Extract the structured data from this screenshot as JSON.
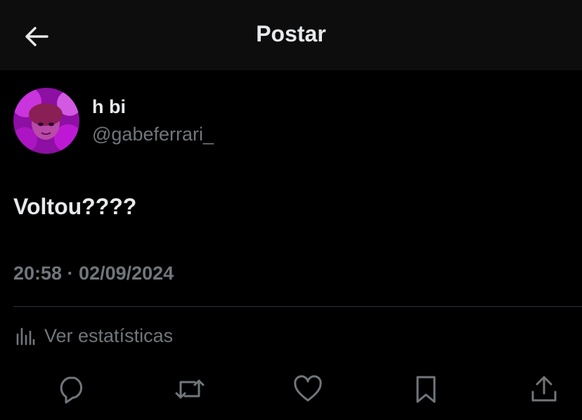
{
  "header": {
    "title": "Postar",
    "back_icon": "arrow-left-icon"
  },
  "author": {
    "display_name": "h bi",
    "handle": "@gabeferrari_",
    "avatar_colors": [
      "#c21bd9",
      "#7a0c8a",
      "#e46cf0"
    ]
  },
  "tweet": {
    "text": "Voltou????",
    "timestamp": "20:58 · 02/09/2024"
  },
  "stats": {
    "label": "Ver estatísticas",
    "icon": "bar-chart-icon"
  },
  "actions": [
    {
      "icon": "reply-icon"
    },
    {
      "icon": "retweet-icon"
    },
    {
      "icon": "like-icon"
    },
    {
      "icon": "bookmark-icon"
    },
    {
      "icon": "share-icon"
    }
  ],
  "colors": {
    "background": "#000000",
    "header_background": "#0d0d0d",
    "primary_text": "#e7e9ea",
    "secondary_text": "#71767b",
    "divider": "#2f3336"
  }
}
